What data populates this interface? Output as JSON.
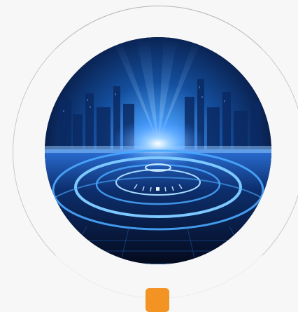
{
  "hero": {
    "image_alt_icon": "futuristic-city-hologram-image"
  },
  "pager": {
    "active_dot_color": "#f39323",
    "icon": "square-dot-indicator"
  },
  "colors": {
    "background": "#f7f7f8",
    "ring": "#b5b5b7",
    "glow": "#3b8cff"
  }
}
